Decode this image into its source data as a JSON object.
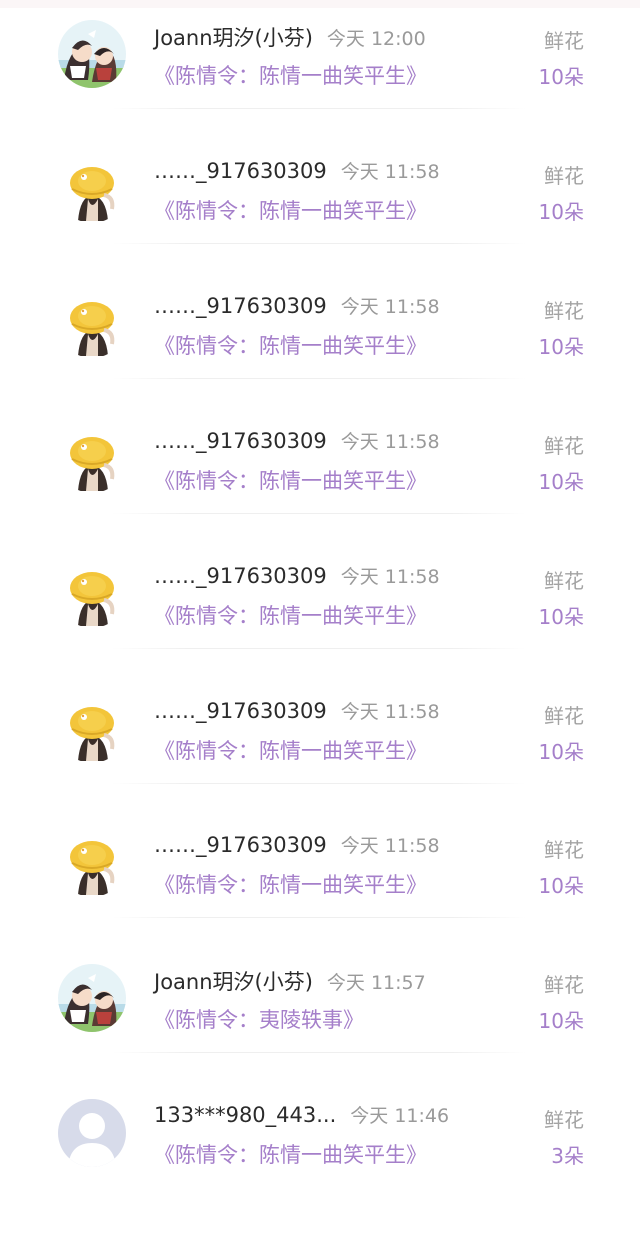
{
  "rows": [
    {
      "avatar": "anime-couple-avatar",
      "name": "Joann玥汐(小芬)",
      "time": "今天 12:00",
      "book": "《陈情令：陈情一曲笑平生》",
      "gift": "鲜花",
      "count": "10朵"
    },
    {
      "avatar": "yellow-hat-girl-avatar",
      "name": "……_917630309",
      "time": "今天 11:58",
      "book": "《陈情令：陈情一曲笑平生》",
      "gift": "鲜花",
      "count": "10朵"
    },
    {
      "avatar": "yellow-hat-girl-avatar",
      "name": "……_917630309",
      "time": "今天 11:58",
      "book": "《陈情令：陈情一曲笑平生》",
      "gift": "鲜花",
      "count": "10朵"
    },
    {
      "avatar": "yellow-hat-girl-avatar",
      "name": "……_917630309",
      "time": "今天 11:58",
      "book": "《陈情令：陈情一曲笑平生》",
      "gift": "鲜花",
      "count": "10朵"
    },
    {
      "avatar": "yellow-hat-girl-avatar",
      "name": "……_917630309",
      "time": "今天 11:58",
      "book": "《陈情令：陈情一曲笑平生》",
      "gift": "鲜花",
      "count": "10朵"
    },
    {
      "avatar": "yellow-hat-girl-avatar",
      "name": "……_917630309",
      "time": "今天 11:58",
      "book": "《陈情令：陈情一曲笑平生》",
      "gift": "鲜花",
      "count": "10朵"
    },
    {
      "avatar": "yellow-hat-girl-avatar",
      "name": "……_917630309",
      "time": "今天 11:58",
      "book": "《陈情令：陈情一曲笑平生》",
      "gift": "鲜花",
      "count": "10朵"
    },
    {
      "avatar": "anime-couple-avatar",
      "name": "Joann玥汐(小芬)",
      "time": "今天 11:57",
      "book": "《陈情令：夷陵轶事》",
      "gift": "鲜花",
      "count": "10朵"
    },
    {
      "avatar": "default-user-avatar",
      "name": "133***980_443...",
      "time": "今天 11:46",
      "book": "《陈情令：陈情一曲笑平生》",
      "gift": "鲜花",
      "count": "3朵"
    }
  ],
  "colors": {
    "accent": "#a57fca",
    "name_text": "#2b2b2b",
    "muted_text": "#9a9a9a",
    "hat_yellow": "#f3c53a",
    "default_avatar_bg": "#d7dbea"
  }
}
